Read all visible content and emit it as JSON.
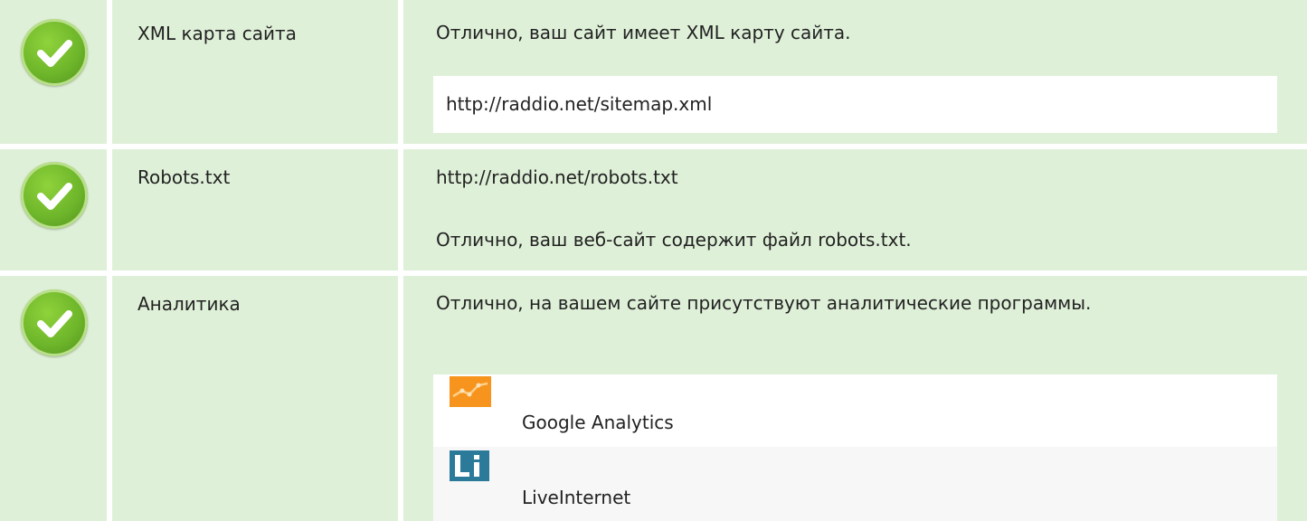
{
  "rows": [
    {
      "name": "XML карта сайта",
      "message": "Отлично, ваш сайт имеет XML карту сайта.",
      "url": "http://raddio.net/sitemap.xml"
    },
    {
      "name": "Robots.txt",
      "url": "http://raddio.net/robots.txt",
      "message": "Отлично, ваш веб-сайт содержит файл robots.txt."
    },
    {
      "name": "Аналитика",
      "message": "Отлично, на вашем сайте присутствуют аналитические программы.",
      "tools": [
        {
          "name": "Google Analytics",
          "icon": "google-analytics-icon"
        },
        {
          "name": "LiveInternet",
          "icon": "liveinternet-icon"
        }
      ]
    }
  ],
  "colors": {
    "row_background": "#dff0d8",
    "check_green": "#6db52a",
    "analytics_orange": "#f7941d",
    "liveinternet_teal": "#2b7a9a"
  }
}
